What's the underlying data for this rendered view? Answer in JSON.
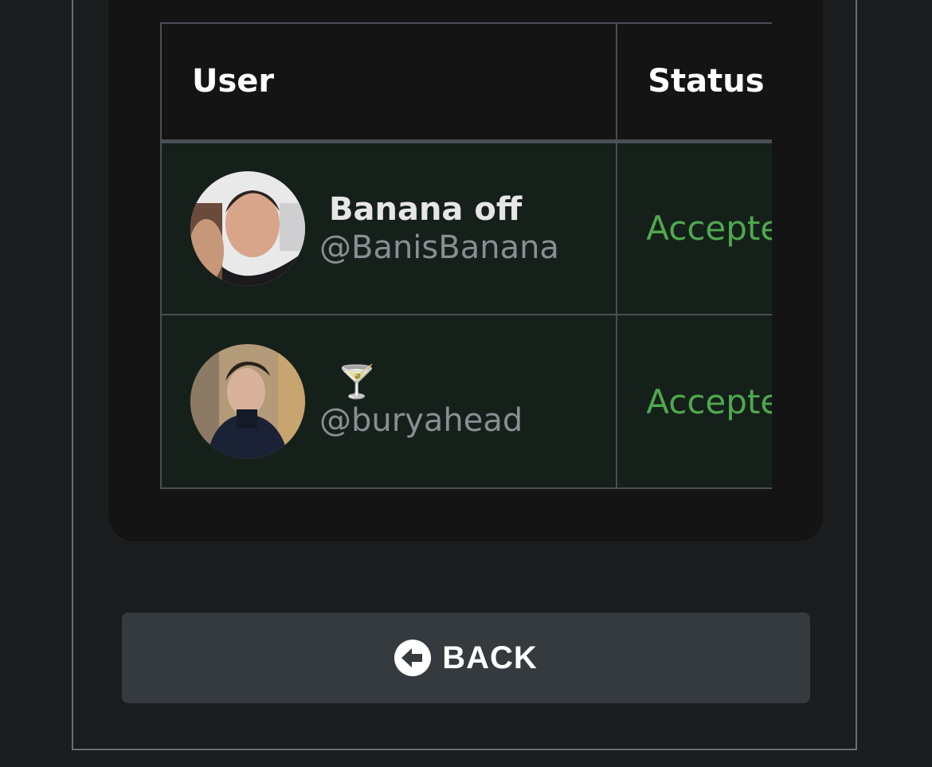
{
  "table": {
    "columns": [
      {
        "label": "User"
      },
      {
        "label": "Status"
      }
    ],
    "rows": [
      {
        "display_name": "Banana off",
        "handle": "@BanisBanana",
        "status": "Accepted"
      },
      {
        "display_name": "🍸",
        "handle": "@buryahead",
        "status": "Accepted"
      }
    ]
  },
  "back_button": {
    "label": "BACK",
    "icon": "arrow-left-circle-icon"
  },
  "colors": {
    "background": "#1b1c1e",
    "card": "#141414",
    "row_background": "#16201a",
    "accepted": "#4fa84f",
    "button": "#353a3f"
  }
}
